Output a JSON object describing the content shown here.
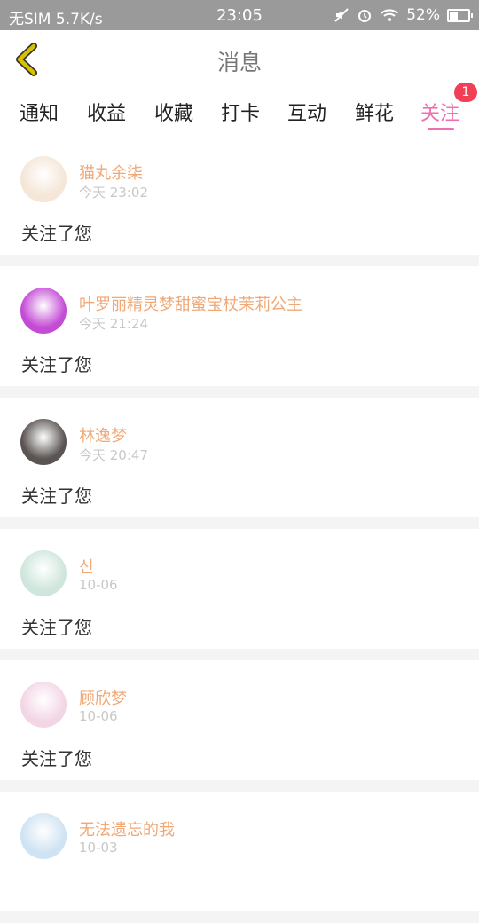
{
  "status_bar": {
    "carrier": "无SIM 5.7K/s",
    "time": "23:05",
    "battery_text": "52%",
    "battery_level": 0.52
  },
  "header": {
    "title": "消息"
  },
  "tabs": [
    {
      "label": "通知"
    },
    {
      "label": "收益"
    },
    {
      "label": "收藏"
    },
    {
      "label": "打卡"
    },
    {
      "label": "互动"
    },
    {
      "label": "鲜花"
    },
    {
      "label": "关注",
      "badge": "1",
      "active": true
    }
  ],
  "messages": [
    {
      "name": "猫丸余柒",
      "time": "今天 23:02",
      "text": "关注了您",
      "avatar_color": "#f5e6d8"
    },
    {
      "name": "叶罗丽精灵梦甜蜜宝杖茉莉公主",
      "time": "今天 21:24",
      "text": "关注了您",
      "avatar_color": "#c44bd6"
    },
    {
      "name": "林逸梦",
      "time": "今天 20:47",
      "text": "关注了您",
      "avatar_color": "#5a5452"
    },
    {
      "name": "신",
      "time": "10-06",
      "text": "关注了您",
      "avatar_color": "#cfe6dc"
    },
    {
      "name": "顾欣梦",
      "time": "10-06",
      "text": "关注了您",
      "avatar_color": "#f3d6e6"
    },
    {
      "name": "无法遗忘的我",
      "time": "10-03",
      "text": "",
      "avatar_color": "#cfe3f3"
    }
  ],
  "colors": {
    "accent": "#ef6fb0",
    "name": "#f0a877",
    "badge": "#f23f56",
    "back_arrow": "#d9c000"
  }
}
